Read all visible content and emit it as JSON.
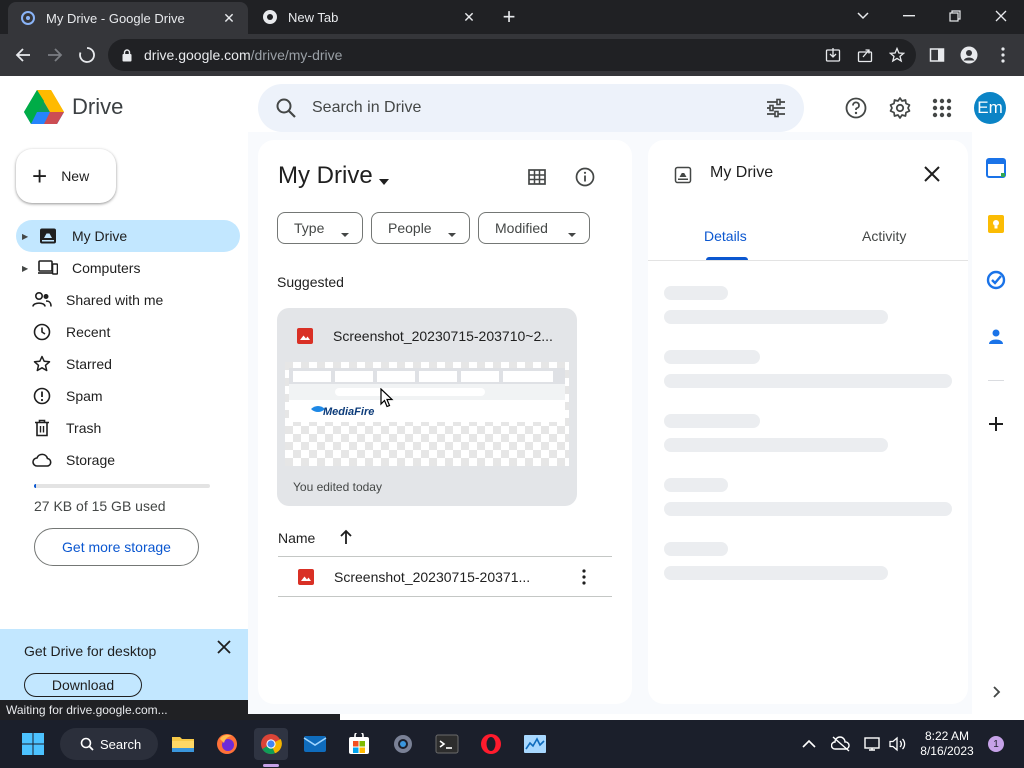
{
  "browser": {
    "tabs": [
      {
        "title": "My Drive - Google Drive",
        "active": true
      },
      {
        "title": "New Tab",
        "active": false
      }
    ],
    "url_host": "drive.google.com",
    "url_path": "/drive/my-drive",
    "status_text": "Waiting for drive.google.com..."
  },
  "header": {
    "app_name": "Drive",
    "search_placeholder": "Search in Drive",
    "avatar_initials": "Em"
  },
  "sidebar": {
    "new_label": "New",
    "items": [
      {
        "label": "My Drive",
        "icon": "my-drive-icon",
        "active": true
      },
      {
        "label": "Computers",
        "icon": "computers-icon"
      },
      {
        "label": "Shared with me",
        "icon": "shared-icon"
      },
      {
        "label": "Recent",
        "icon": "clock-icon"
      },
      {
        "label": "Starred",
        "icon": "star-icon"
      },
      {
        "label": "Spam",
        "icon": "spam-icon"
      },
      {
        "label": "Trash",
        "icon": "trash-icon"
      },
      {
        "label": "Storage",
        "icon": "cloud-icon"
      }
    ],
    "storage_used_text": "27 KB of 15 GB used",
    "storage_used_fraction": 0.01,
    "get_storage_label": "Get more storage"
  },
  "promo": {
    "title": "Get Drive for desktop",
    "download_label": "Download"
  },
  "main": {
    "title": "My Drive",
    "filters": [
      "Type",
      "People",
      "Modified"
    ],
    "suggested_label": "Suggested",
    "suggested_card": {
      "name": "Screenshot_20230715-203710~2...",
      "meta": "You edited today",
      "thumb_text": "MediaFire"
    },
    "list_header_name": "Name",
    "files": [
      {
        "name": "Screenshot_20230715-20371..."
      }
    ]
  },
  "details": {
    "title": "My Drive",
    "tabs": [
      "Details",
      "Activity"
    ]
  },
  "taskbar": {
    "search_label": "Search",
    "time": "8:22 AM",
    "date": "8/16/2023",
    "notification_count": "1"
  }
}
